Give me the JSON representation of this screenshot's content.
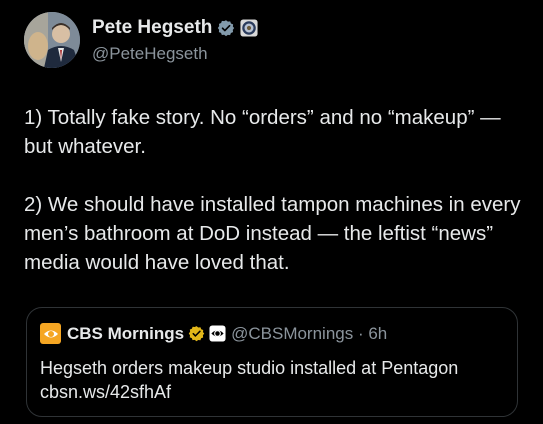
{
  "tweet": {
    "author": {
      "display_name": "Pete Hegseth",
      "handle": "@PeteHegseth",
      "verified_icon": "gray-verified-badge-icon",
      "affiliation_icon": "dod-seal-icon"
    },
    "paragraphs": [
      "1) Totally fake story. No “orders” and no “makeup” — but whatever.",
      "2) We should have installed tampon machines in every men’s bathroom at DoD instead — the leftist “news” media would have loved that."
    ]
  },
  "quoted_tweet": {
    "avatar_icon": "cbs-eye-logo-icon",
    "display_name": "CBS Mornings",
    "verified_icon": "gold-verified-badge-icon",
    "affiliation_icon": "cbs-eye-badge-icon",
    "handle": "@CBSMornings · 6h",
    "text_line1": "Hegseth orders makeup studio installed at Pentagon",
    "text_line2": "cbsn.ws/42sfhAf"
  },
  "colors": {
    "background": "#000000",
    "primary_text": "#e7e9ea",
    "secondary_text": "#8b949c",
    "border": "#2f3336",
    "gold_badge": "#e2b719",
    "gray_badge": "#829aab"
  }
}
